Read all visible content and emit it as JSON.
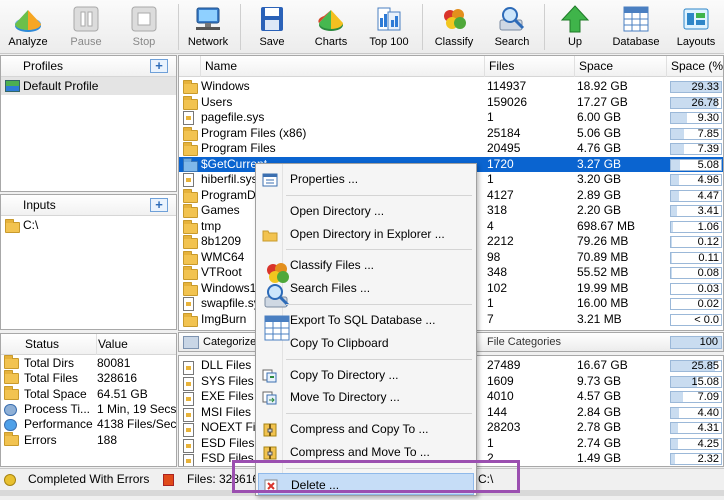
{
  "toolbar": {
    "buttons": [
      {
        "label": "Analyze",
        "icon": "analyze-icon"
      },
      {
        "label": "Pause",
        "icon": "pause-icon",
        "disabled": true
      },
      {
        "label": "Stop",
        "icon": "stop-icon",
        "disabled": true
      },
      {
        "label": "Network",
        "icon": "network-icon"
      },
      {
        "label": "Save",
        "icon": "save-icon"
      },
      {
        "label": "Charts",
        "icon": "charts-icon"
      },
      {
        "label": "Top 100",
        "icon": "top100-icon"
      },
      {
        "label": "Classify",
        "icon": "classify-icon"
      },
      {
        "label": "Search",
        "icon": "search-icon"
      },
      {
        "label": "Up",
        "icon": "up-arrow-icon"
      },
      {
        "label": "Database",
        "icon": "database-icon"
      },
      {
        "label": "Layouts",
        "icon": "layouts-icon"
      }
    ]
  },
  "profiles": {
    "title": "Profiles",
    "items": [
      "Default Profile"
    ]
  },
  "inputs": {
    "title": "Inputs",
    "items": [
      "C:\\"
    ]
  },
  "status_panel": {
    "headers": [
      "Status",
      "Value"
    ],
    "rows": [
      {
        "label": "Total Dirs",
        "value": "80081"
      },
      {
        "label": "Total Files",
        "value": "328616"
      },
      {
        "label": "Total Space",
        "value": "64.51 GB"
      },
      {
        "label": "Process Ti...",
        "value": "1 Min, 19 Secs"
      },
      {
        "label": "Performance",
        "value": "4138 Files/Sec"
      },
      {
        "label": "Errors",
        "value": "188"
      }
    ]
  },
  "file_list": {
    "headers": {
      "name": "Name",
      "files": "Files",
      "space": "Space",
      "percent": "Space (%)"
    },
    "rows": [
      {
        "name": "Windows",
        "files": "114937",
        "space": "18.92 GB",
        "percent": "29.33",
        "pct": 29.33,
        "type": "folder"
      },
      {
        "name": "Users",
        "files": "159026",
        "space": "17.27 GB",
        "percent": "26.78",
        "pct": 26.78,
        "type": "folder"
      },
      {
        "name": "pagefile.sys",
        "files": "1",
        "space": "6.00 GB",
        "percent": "9.30",
        "pct": 9.3,
        "type": "file"
      },
      {
        "name": "Program Files (x86)",
        "files": "25184",
        "space": "5.06 GB",
        "percent": "7.85",
        "pct": 7.85,
        "type": "folder"
      },
      {
        "name": "Program Files",
        "files": "20495",
        "space": "4.76 GB",
        "percent": "7.39",
        "pct": 7.39,
        "type": "folder"
      },
      {
        "name": "$GetCurrent",
        "files": "1720",
        "space": "3.27 GB",
        "percent": "5.08",
        "pct": 5.08,
        "type": "folder",
        "selected": true
      },
      {
        "name": "hiberfil.sys",
        "files": "1",
        "space": "3.20 GB",
        "percent": "4.96",
        "pct": 4.96,
        "type": "file"
      },
      {
        "name": "ProgramData",
        "files": "4127",
        "space": "2.89 GB",
        "percent": "4.47",
        "pct": 4.47,
        "type": "folder"
      },
      {
        "name": "Games",
        "files": "318",
        "space": "2.20 GB",
        "percent": "3.41",
        "pct": 3.41,
        "type": "folder"
      },
      {
        "name": "tmp",
        "files": "4",
        "space": "698.67 MB",
        "percent": "1.06",
        "pct": 1.06,
        "type": "folder"
      },
      {
        "name": "8b1209",
        "files": "2212",
        "space": "79.26 MB",
        "percent": "0.12",
        "pct": 0.12,
        "type": "folder"
      },
      {
        "name": "WMC64",
        "files": "98",
        "space": "70.89 MB",
        "percent": "0.11",
        "pct": 0.11,
        "type": "folder"
      },
      {
        "name": "VTRoot",
        "files": "348",
        "space": "55.52 MB",
        "percent": "0.08",
        "pct": 0.08,
        "type": "folder"
      },
      {
        "name": "Windows10",
        "files": "102",
        "space": "19.99 MB",
        "percent": "0.03",
        "pct": 0.03,
        "type": "folder"
      },
      {
        "name": "swapfile.sys",
        "files": "1",
        "space": "16.00 MB",
        "percent": "0.02",
        "pct": 0.02,
        "type": "file"
      },
      {
        "name": "ImgBurn",
        "files": "7",
        "space": "3.21 MB",
        "percent": "< 0.0",
        "pct": 0,
        "type": "folder"
      }
    ]
  },
  "categories": {
    "header_left": "Categorize",
    "header_right": "File Categories",
    "header_percent": "100",
    "rows": [
      {
        "name": "DLL Files",
        "files": "27489",
        "space": "16.67 GB",
        "percent": "25.85",
        "pct": 25.85
      },
      {
        "name": "SYS Files",
        "files": "1609",
        "space": "9.73 GB",
        "percent": "15.08",
        "pct": 15.08
      },
      {
        "name": "EXE Files",
        "files": "4010",
        "space": "4.57 GB",
        "percent": "7.09",
        "pct": 7.09
      },
      {
        "name": "MSI Files",
        "files": "144",
        "space": "2.84 GB",
        "percent": "4.40",
        "pct": 4.4
      },
      {
        "name": "NOEXT Files",
        "files": "28203",
        "space": "2.78 GB",
        "percent": "4.31",
        "pct": 4.31
      },
      {
        "name": "ESD Files",
        "files": "1",
        "space": "2.74 GB",
        "percent": "4.25",
        "pct": 4.25
      },
      {
        "name": "FSD Files",
        "files": "2",
        "space": "1.49 GB",
        "percent": "2.32",
        "pct": 2.32
      }
    ]
  },
  "context_menu": {
    "items": [
      {
        "label": "Properties ...",
        "icon": "properties-icon"
      },
      {
        "sep": true
      },
      {
        "label": "Open Directory ...",
        "icon": ""
      },
      {
        "label": "Open Directory in Explorer ...",
        "icon": "folder-icon"
      },
      {
        "sep": true
      },
      {
        "label": "Classify Files ...",
        "icon": "classify-icon"
      },
      {
        "label": "Search Files ...",
        "icon": "search-icon"
      },
      {
        "sep": true
      },
      {
        "label": "Export To SQL Database ...",
        "icon": "database-icon"
      },
      {
        "label": "Copy To Clipboard",
        "icon": ""
      },
      {
        "sep": true
      },
      {
        "label": "Copy To Directory ...",
        "icon": "copy-icon"
      },
      {
        "label": "Move To Directory ...",
        "icon": "move-icon"
      },
      {
        "sep": true
      },
      {
        "label": "Compress and Copy To ...",
        "icon": "compress-icon"
      },
      {
        "label": "Compress and Move To ...",
        "icon": "compress-icon"
      },
      {
        "sep": true
      },
      {
        "label": "Delete ...",
        "icon": "delete-icon",
        "highlighted": true
      }
    ]
  },
  "statusbar": {
    "status": "Completed With Errors",
    "files": "Files: 328616",
    "path": "C:\\"
  },
  "colors": {
    "selection": "#0a64d0",
    "accent_box": "#9b4fb0"
  }
}
